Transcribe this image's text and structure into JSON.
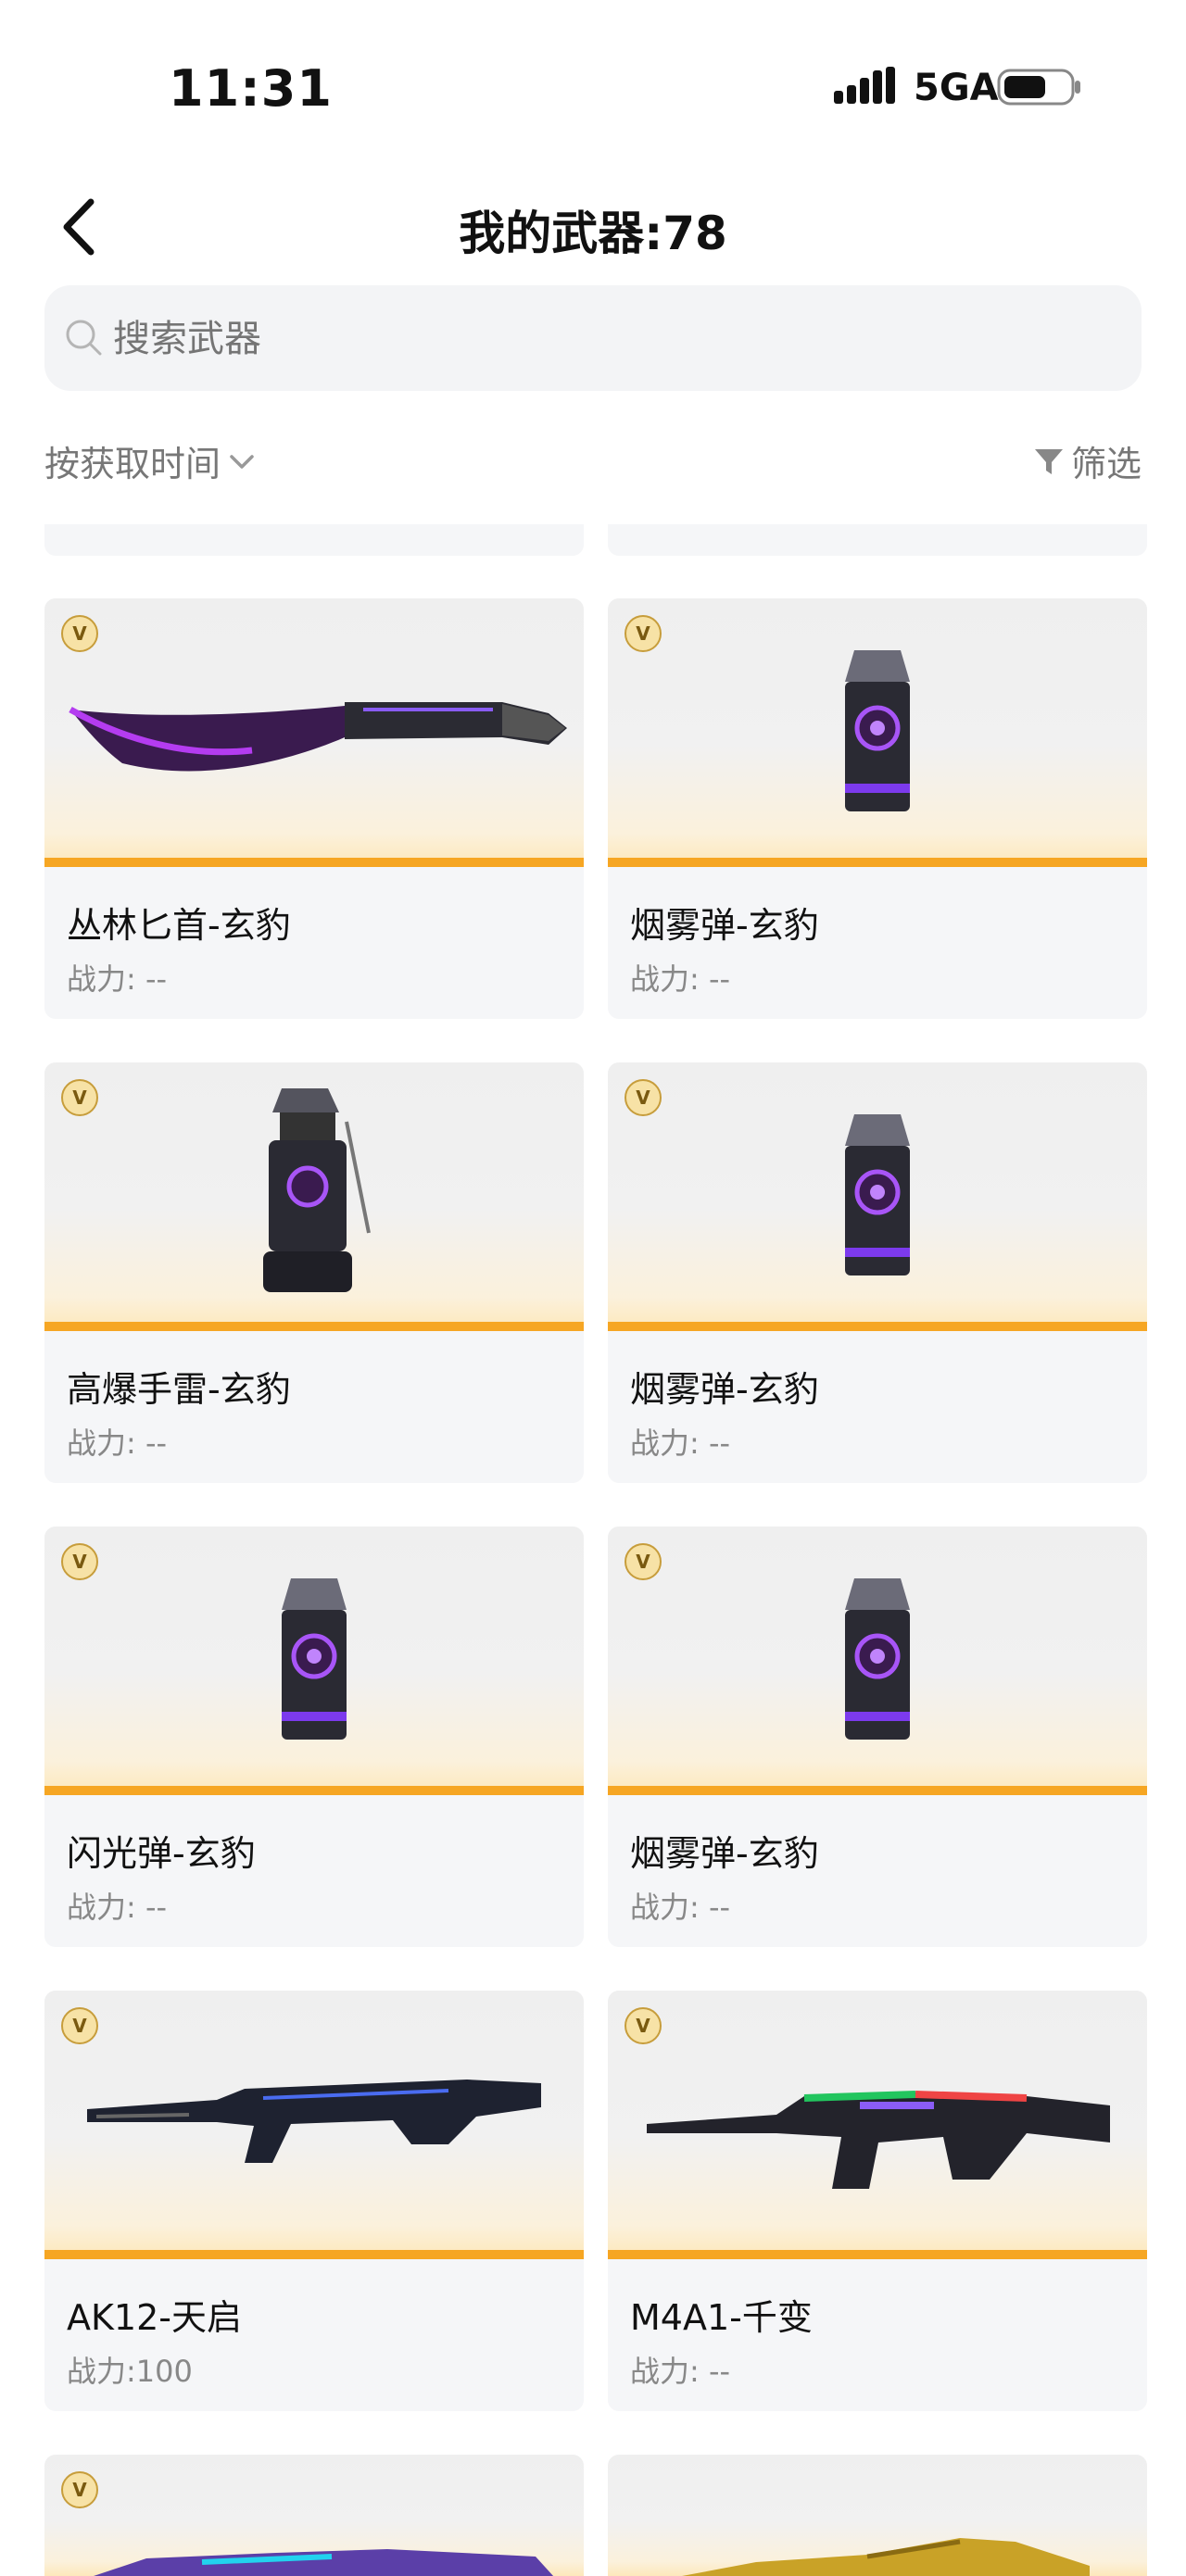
{
  "status_bar": {
    "time": "11:31",
    "network": "5GA"
  },
  "header": {
    "title": "我的武器:78"
  },
  "search": {
    "placeholder": "搜索武器"
  },
  "sort": {
    "label": "按获取时间"
  },
  "filter": {
    "label": "筛选"
  },
  "badge_letter": "V",
  "items": [
    {
      "name": "丛林匕首-玄豹",
      "power": "战力: --"
    },
    {
      "name": "烟雾弹-玄豹",
      "power": "战力: --"
    },
    {
      "name": "高爆手雷-玄豹",
      "power": "战力: --"
    },
    {
      "name": "烟雾弹-玄豹",
      "power": "战力: --"
    },
    {
      "name": "闪光弹-玄豹",
      "power": "战力: --"
    },
    {
      "name": "烟雾弹-玄豹",
      "power": "战力: --"
    },
    {
      "name": "AK12-天启",
      "power": "战力:100"
    },
    {
      "name": "M4A1-千变",
      "power": "战力: --"
    }
  ],
  "colors": {
    "accent_bar": "#f6a623",
    "card_bg": "#f5f6f8",
    "search_bg": "#f3f4f6"
  }
}
